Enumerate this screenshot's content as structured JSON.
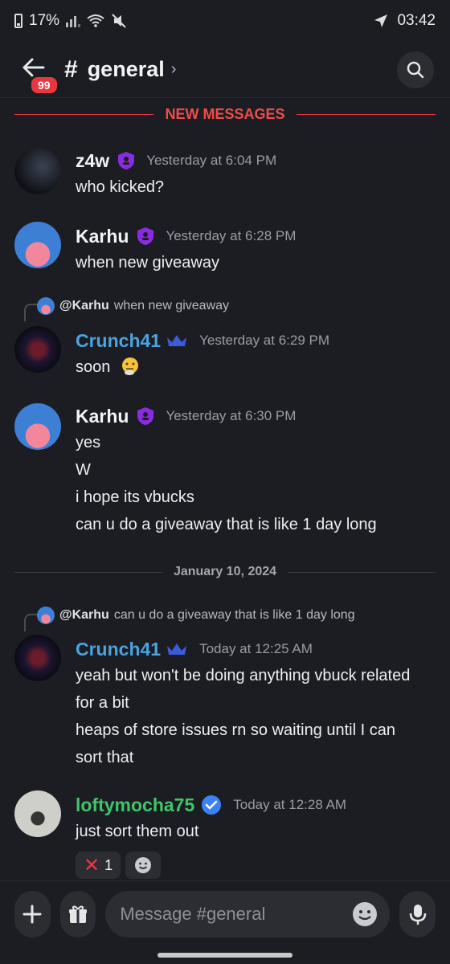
{
  "status_bar": {
    "battery": "17%",
    "time": "03:42"
  },
  "header": {
    "back_badge": "99",
    "hash": "#",
    "channel": "general",
    "chevron": "›"
  },
  "dividers": {
    "new_messages": "NEW MESSAGES",
    "date": "January 10, 2024"
  },
  "messages": [
    {
      "author": "z4w",
      "author_color": "#f2f3f5",
      "timestamp": "Yesterday at 6:04 PM",
      "lines": [
        "who kicked?"
      ]
    },
    {
      "author": "Karhu",
      "author_color": "#f2f3f5",
      "timestamp": "Yesterday at 6:28 PM",
      "lines": [
        "when new giveaway"
      ]
    },
    {
      "reply_to": "@Karhu",
      "reply_text": "when new giveaway",
      "author": "Crunch41",
      "author_color": "#4aa3df",
      "timestamp": "Yesterday at 6:29 PM",
      "lines": [
        "soon"
      ]
    },
    {
      "author": "Karhu",
      "author_color": "#f2f3f5",
      "timestamp": "Yesterday at 6:30 PM",
      "lines": [
        "yes",
        "W",
        "i hope its vbucks",
        "can u do a giveaway that is like 1 day long"
      ]
    },
    {
      "reply_to": "@Karhu",
      "reply_text": "can u do a giveaway that is like 1 day long",
      "author": "Crunch41",
      "author_color": "#4aa3df",
      "timestamp": "Today at 12:25 AM",
      "lines": [
        "yeah but won't be doing anything vbuck related",
        "for a bit",
        "heaps of store issues rn so waiting until I can",
        "sort that"
      ]
    },
    {
      "author": "loftymocha75",
      "author_color": "#3ec56b",
      "timestamp": "Today at 12:28 AM",
      "lines": [
        "just sort them out"
      ],
      "reaction_count": "1"
    }
  ],
  "composer": {
    "placeholder": "Message #general"
  },
  "colors": {
    "accent_red": "#e8383f",
    "role_purple": "#8a2be2",
    "crown_blue": "#3b5bdb"
  }
}
